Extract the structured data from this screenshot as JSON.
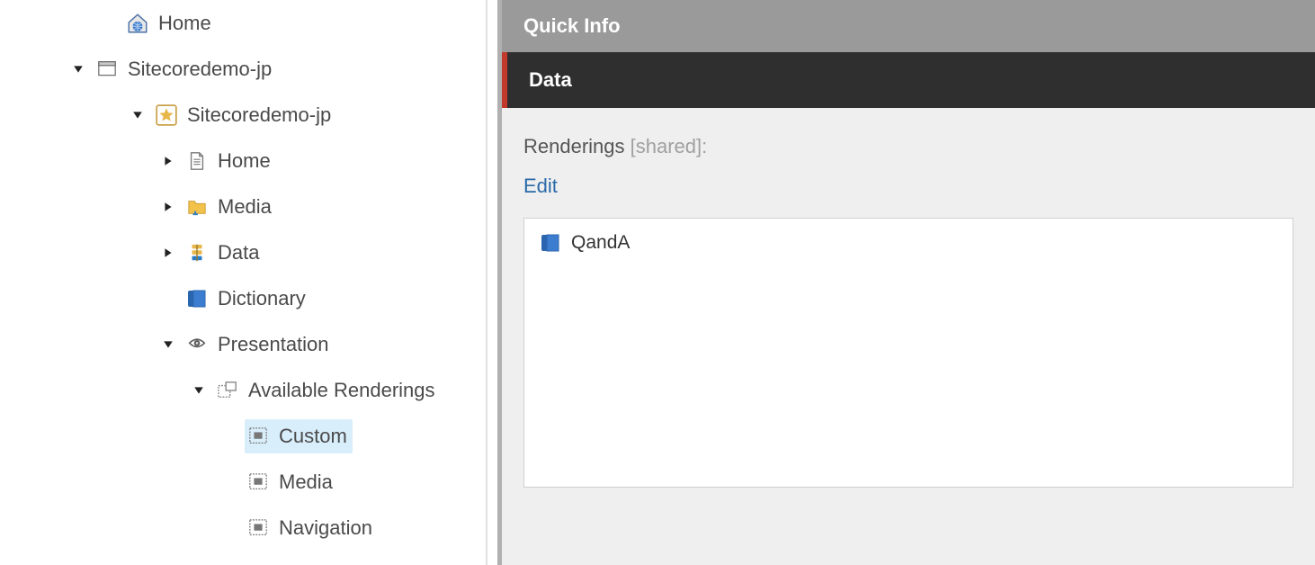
{
  "tree": {
    "home_root": "Home",
    "site": "Sitecoredemo-jp",
    "site_inner": "Sitecoredemo-jp",
    "home": "Home",
    "media": "Media",
    "data": "Data",
    "dictionary": "Dictionary",
    "presentation": "Presentation",
    "available_renderings": "Available Renderings",
    "ar_custom": "Custom",
    "ar_media": "Media",
    "ar_navigation": "Navigation"
  },
  "content": {
    "quick_info": "Quick Info",
    "data_header": "Data",
    "field_label": "Renderings",
    "field_shared": "[shared]:",
    "edit": "Edit",
    "item": "QandA"
  }
}
